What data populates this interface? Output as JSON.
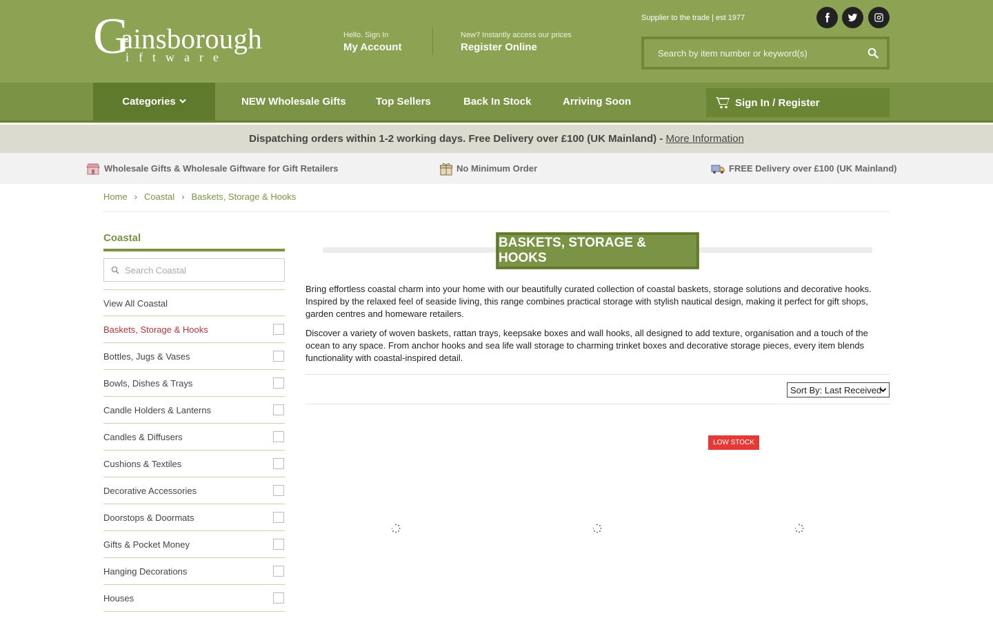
{
  "header": {
    "logo": "Gainsborough Giftware",
    "signin": {
      "small": "Hello. Sign In",
      "big": "My Account"
    },
    "register": {
      "small": "New? Instantly access our prices",
      "big": "Register Online"
    },
    "supplier": "Supplier to the trade | est 1977",
    "social": [
      "facebook-icon",
      "twitter-icon",
      "instagram-icon"
    ],
    "search_placeholder": "Search by item number or keyword(s)"
  },
  "nav": {
    "categories": "Categories",
    "items": [
      "NEW Wholesale Gifts",
      "Top Sellers",
      "Back In Stock",
      "Arriving Soon"
    ],
    "cart": "Sign In / Register"
  },
  "dispatch": {
    "text": "Dispatching orders within 1-2 working days. Free Delivery over £100 (UK Mainland) - ",
    "link": "More Information"
  },
  "usp": [
    "Wholesale Gifts & Wholesale Giftware for Gift Retailers",
    "No Minimum Order",
    "FREE Delivery over £100 (UK Mainland)"
  ],
  "breadcrumb": [
    "Home",
    "Coastal",
    "Baskets, Storage & Hooks"
  ],
  "sidebar": {
    "title": "Coastal",
    "search_placeholder": "Search Coastal",
    "view_all": "View All Coastal",
    "items": [
      "Baskets, Storage & Hooks",
      "Bottles, Jugs & Vases",
      "Bowls, Dishes & Trays",
      "Candle Holders & Lanterns",
      "Candles & Diffusers",
      "Cushions & Textiles",
      "Decorative Accessories",
      "Doorstops & Doormats",
      "Gifts & Pocket Money",
      "Hanging Decorations",
      "Houses"
    ]
  },
  "main": {
    "title": "BASKETS, STORAGE & HOOKS",
    "desc1": "Bring effortless coastal charm into your home with our beautifully curated collection of coastal baskets, storage solutions and decorative hooks. Inspired by the relaxed feel of seaside living, this range combines practical storage with stylish nautical design, making it perfect for gift shops, garden centres and homeware retailers.",
    "desc2": "Discover a variety of woven baskets, rattan trays, keepsake boxes and wall hooks, all designed to add texture, organisation and a touch of the ocean to any space. From anchor hooks and sea life wall storage to charming trinket boxes and decorative storage pieces, every item blends functionality with coastal-inspired detail.",
    "sort": "Sort By: Last Received",
    "badge": "LOW STOCK"
  },
  "colors": {
    "brand_green": "#8ba352",
    "nav_green": "#7b9344",
    "dark_green": "#5f7a2c",
    "active_red": "#b0343a",
    "badge_red": "#e53935"
  }
}
